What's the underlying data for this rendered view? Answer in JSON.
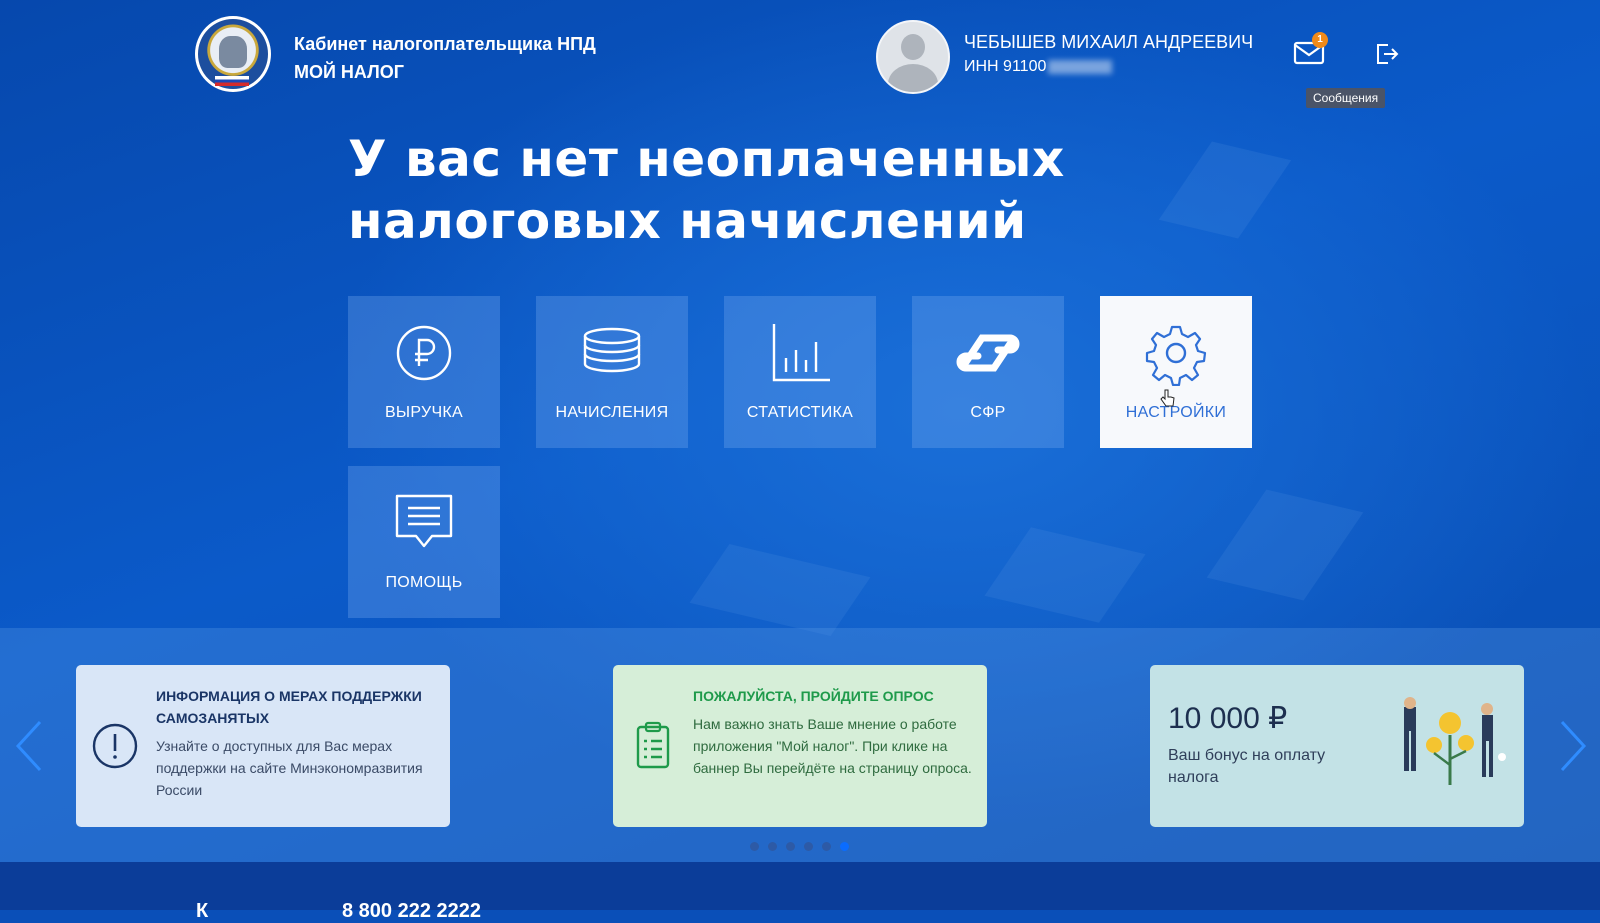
{
  "header": {
    "brand_line1": "Кабинет налогоплательщика НПД",
    "brand_line2": "МОЙ НАЛОГ",
    "user_name": "ЧЕБЫШЕВ МИХАИЛ АНДРЕЕВИЧ",
    "inn_label": "ИНН 91100",
    "messages_badge": "1",
    "messages_tooltip": "Сообщения"
  },
  "headline": "У вас нет неоплаченных налоговых начислений",
  "tiles": [
    {
      "label": "ВЫРУЧКА",
      "icon": "ruble-icon"
    },
    {
      "label": "НАЧИСЛЕНИЯ",
      "icon": "coins-stack-icon"
    },
    {
      "label": "СТАТИСТИКА",
      "icon": "bar-chart-icon"
    },
    {
      "label": "СФР",
      "icon": "sfr-logo-icon"
    },
    {
      "label": "НАСТРОЙКИ",
      "icon": "gear-icon",
      "active": true
    },
    {
      "label": "ПОМОЩЬ",
      "icon": "chat-icon"
    }
  ],
  "cards": {
    "support": {
      "title": "ИНФОРМАЦИЯ О МЕРАХ ПОДДЕРЖКИ САМОЗАНЯТЫХ",
      "text": "Узнайте о доступных для Вас мерах поддержки на сайте Минэкономразвития России"
    },
    "survey": {
      "title": "ПОЖАЛУЙСТА, ПРОЙДИТЕ ОПРОС",
      "text": "Нам важно знать Ваше мнение о работе приложения \"Мой налог\". При клике на баннер Вы перейдёте на страницу опроса."
    },
    "bonus": {
      "amount": "10 000 ₽",
      "text": "Ваш бонус на оплату налога"
    }
  },
  "carousel": {
    "total_dots": 6,
    "active_dot": 6
  },
  "footer": {
    "text_left": "К",
    "text_mid": "8 800 222 2222"
  },
  "colors": {
    "accent": "#2f6fd6",
    "background": "#0a4fb8",
    "badge": "#f08a1a",
    "survey_green": "#1e9a4a"
  }
}
